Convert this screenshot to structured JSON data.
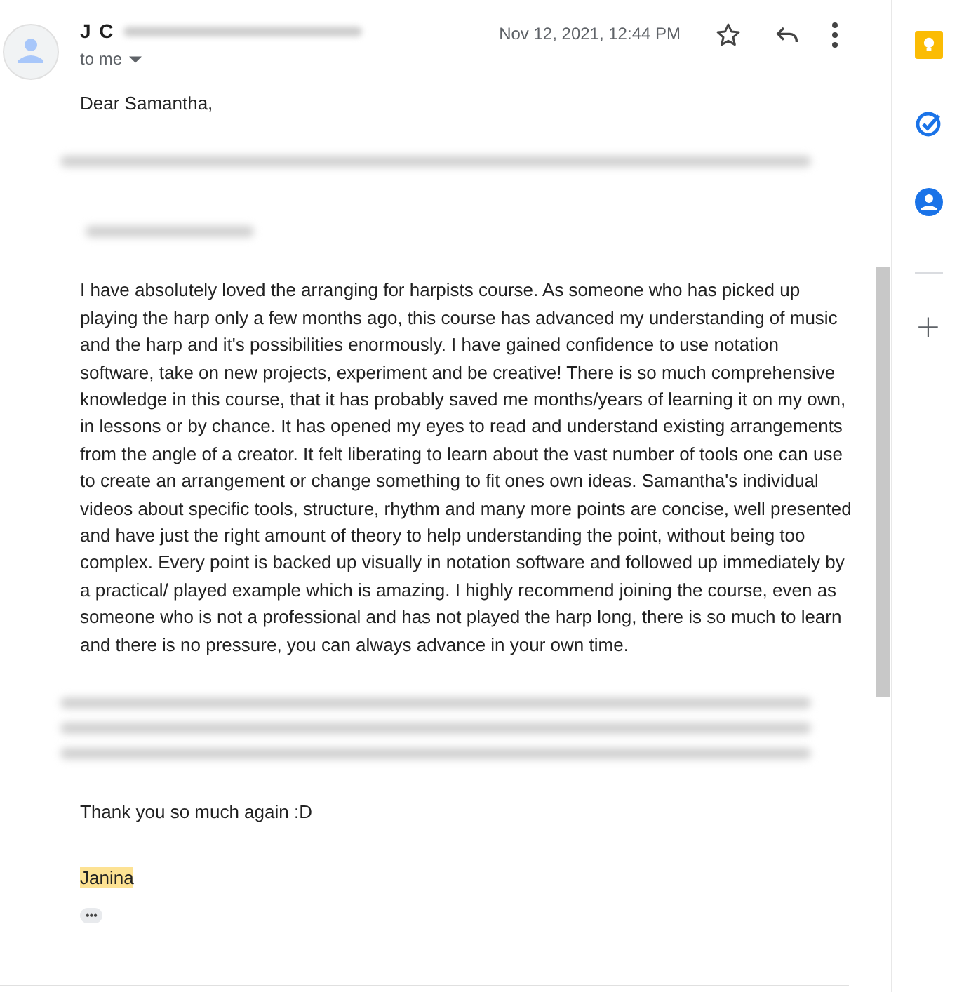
{
  "message": {
    "sender": "J C",
    "recipient": "to me",
    "date": "Nov 12, 2021, 12:44 PM",
    "starred": false,
    "body": [
      {
        "kind": "text",
        "text": "Dear Samantha,"
      },
      {
        "kind": "redacted"
      },
      {
        "kind": "redacted"
      },
      {
        "kind": "text",
        "text": "I have absolutely loved the arranging for harpists course. As someone who has picked up playing the harp only a few months ago, this course has advanced my understanding of music and the harp and it's possibilities enormously. I have gained confidence to use notation software, take on new projects, experiment and be creative! There is so much comprehensive knowledge in this course, that it has probably saved me months/years of learning it on my own, in lessons or by chance. It has opened my eyes to read and understand existing arrangements from the angle of a creator. It felt liberating to learn about the vast number of tools one can use to create an arrangement or change something to fit ones own ideas. Samantha's individual videos about specific tools, structure, rhythm and many more points are concise, well presented and have just the right amount of theory to help understanding the point, without being too complex. Every point is backed up visually in notation software and followed up immediately by a practical/ played example which is amazing. I highly recommend joining the course, even as someone who is not a professional and has not played the harp long, there is so much to learn and there is no pressure, you can always advance in your own time."
      },
      {
        "kind": "redacted"
      },
      {
        "kind": "redacted"
      },
      {
        "kind": "redacted"
      },
      {
        "kind": "text",
        "text": "Thank you so much again :D"
      },
      {
        "kind": "signature",
        "text": "Janina"
      }
    ],
    "trimmed_marker": "•••"
  },
  "side_panel": {
    "apps": [
      {
        "kind": "keep"
      },
      {
        "kind": "tasks"
      },
      {
        "kind": "contacts"
      }
    ],
    "add_label": "+"
  }
}
